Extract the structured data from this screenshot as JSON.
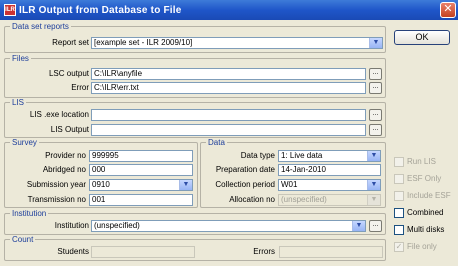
{
  "window": {
    "title": "ILR Output from Database to File",
    "icon_text": "ILR"
  },
  "buttons": {
    "ok": "OK",
    "close": "✕",
    "browse": "..."
  },
  "dataset": {
    "group_title": "Data set reports",
    "report_set_label": "Report set",
    "report_set_value": "[example set - ILR 2009/10]"
  },
  "files": {
    "group_title": "Files",
    "lsc_output_label": "LSC output",
    "lsc_output_value": "C:\\ILR\\anyfile",
    "error_label": "Error",
    "error_value": "C:\\ILR\\err.txt"
  },
  "lis": {
    "group_title": "LIS",
    "exe_label": "LIS .exe location",
    "exe_value": "",
    "output_label": "LIS Output",
    "output_value": ""
  },
  "survey": {
    "group_title": "Survey",
    "provider_label": "Provider no",
    "provider_value": "999995",
    "abridged_label": "Abridged no",
    "abridged_value": "000",
    "submission_label": "Submission year",
    "submission_value": "0910",
    "transmission_label": "Transmission no",
    "transmission_value": "001"
  },
  "data": {
    "group_title": "Data",
    "datatype_label": "Data type",
    "datatype_value": "1: Live data",
    "prepdate_label": "Preparation date",
    "prepdate_value": "14-Jan-2010",
    "collection_label": "Collection period",
    "collection_value": "W01",
    "allocation_label": "Allocation no",
    "allocation_value": "(unspecified)"
  },
  "institution": {
    "group_title": "Institution",
    "label": "Institution",
    "value": "(unspecified)"
  },
  "count": {
    "group_title": "Count",
    "students_label": "Students",
    "students_value": "",
    "errors_label": "Errors",
    "errors_value": ""
  },
  "options": {
    "run_lis": "Run LIS",
    "esf_only": "ESF Only",
    "include_esf": "Include ESF",
    "combined": "Combined",
    "multi_disks": "Multi disks",
    "file_only": "File only"
  }
}
